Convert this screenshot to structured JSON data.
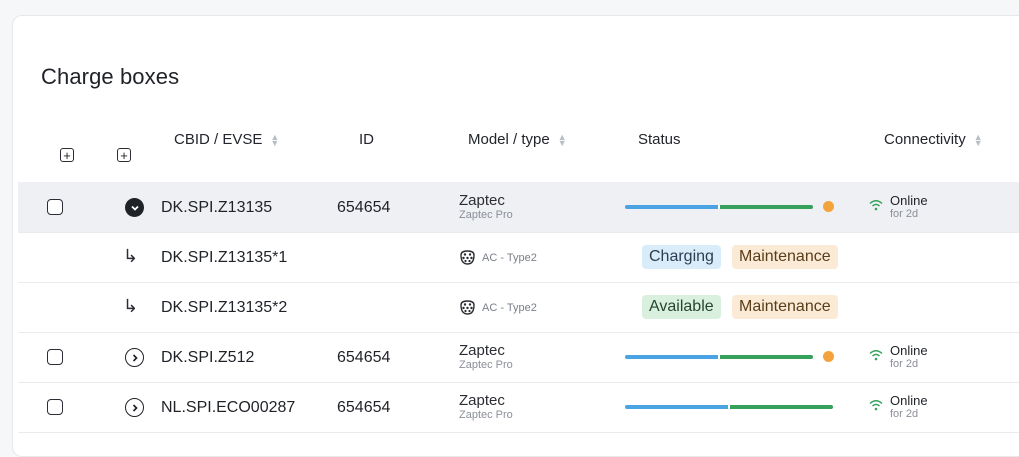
{
  "page": {
    "title": "Charge boxes"
  },
  "table": {
    "headers": {
      "cbid": "CBID / EVSE",
      "id": "ID",
      "model": "Model / type",
      "status": "Status",
      "connectivity": "Connectivity"
    },
    "rows": [
      {
        "cbid": "DK.SPI.Z13135",
        "id": "654654",
        "model": "Zaptec",
        "model_sub": "Zaptec Pro",
        "expanded": true,
        "status_bar": {
          "blue": 0.45,
          "green": 0.45
        },
        "status_dot": true,
        "conn": "Online",
        "conn_sub": "for 2d"
      },
      {
        "cbid": "DK.SPI.Z13135*1",
        "plug": "AC - Type2",
        "tags": [
          "Charging",
          "Maintenance"
        ]
      },
      {
        "cbid": "DK.SPI.Z13135*2",
        "plug": "AC - Type2",
        "tags": [
          "Available",
          "Maintenance"
        ]
      },
      {
        "cbid": "DK.SPI.Z512",
        "id": "654654",
        "model": "Zaptec",
        "model_sub": "Zaptec Pro",
        "expanded": false,
        "status_bar": {
          "blue": 0.45,
          "green": 0.45
        },
        "status_dot": true,
        "conn": "Online",
        "conn_sub": "for 2d"
      },
      {
        "cbid": "NL.SPI.ECO00287",
        "id": "654654",
        "model": "Zaptec",
        "model_sub": "Zaptec Pro",
        "expanded": false,
        "status_bar": {
          "blue": 0.5,
          "green": 0.5
        },
        "status_dot": false,
        "conn": "Online",
        "conn_sub": "for 2d"
      }
    ]
  },
  "icons": {
    "expand_all": "plus-square-icon",
    "select_all": "plus-square-icon",
    "sort": "sort-icon",
    "wifi": "wifi-icon",
    "plug": "type2-plug-icon",
    "child": "return-arrow-icon"
  },
  "colors": {
    "blue": "#4aa3e3",
    "green": "#36a15a",
    "orange": "#f3a33b",
    "online": "#36a15a"
  }
}
